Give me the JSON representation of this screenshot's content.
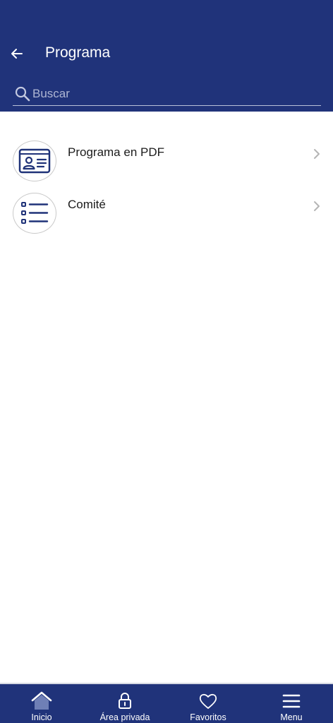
{
  "header": {
    "title": "Programa",
    "back_icon": "arrow-left-icon",
    "background_color": "#20337a"
  },
  "search": {
    "placeholder": "Buscar",
    "value": ""
  },
  "list": {
    "items": [
      {
        "label": "Programa en PDF",
        "icon": "id-card-icon"
      },
      {
        "label": "Comité",
        "icon": "list-icon"
      }
    ]
  },
  "bottom_nav": {
    "items": [
      {
        "label": "Inicio",
        "icon": "home-icon"
      },
      {
        "label": "Área privada",
        "icon": "lock-icon"
      },
      {
        "label": "Favoritos",
        "icon": "heart-icon"
      },
      {
        "label": "Menu",
        "icon": "hamburger-icon"
      }
    ]
  },
  "colors": {
    "primary": "#20337a",
    "icon_blue": "#1f3278",
    "text": "#1b1b1b",
    "chevron": "#b5b5b5"
  }
}
